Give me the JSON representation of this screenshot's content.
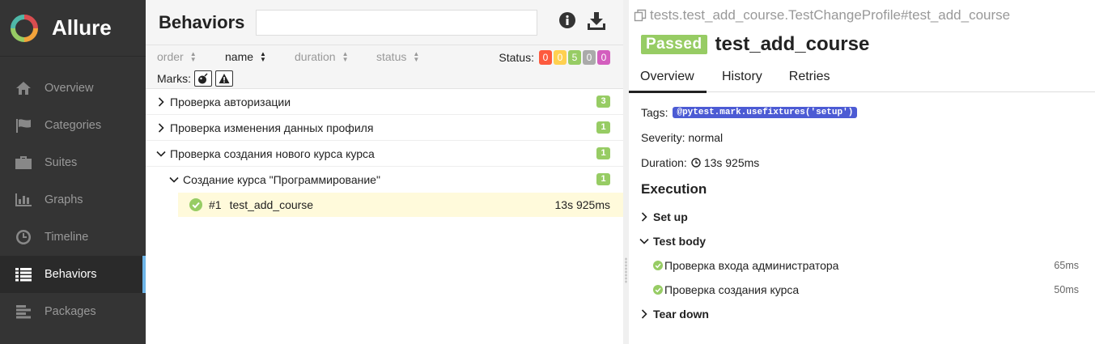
{
  "app": {
    "name": "Allure"
  },
  "sidebar": {
    "items": [
      {
        "label": "Overview",
        "icon": "home-icon"
      },
      {
        "label": "Categories",
        "icon": "flag-icon"
      },
      {
        "label": "Suites",
        "icon": "briefcase-icon"
      },
      {
        "label": "Graphs",
        "icon": "bar-chart-icon"
      },
      {
        "label": "Timeline",
        "icon": "clock-icon"
      },
      {
        "label": "Behaviors",
        "icon": "list-icon",
        "active": true
      },
      {
        "label": "Packages",
        "icon": "align-left-icon"
      }
    ]
  },
  "behaviors": {
    "title": "Behaviors",
    "search": {
      "value": "",
      "placeholder": ""
    },
    "sort": {
      "order": "order",
      "name": "name",
      "duration": "duration",
      "status": "status"
    },
    "status_label": "Status:",
    "status_counts": [
      {
        "value": "0",
        "color": "#fd5a3e"
      },
      {
        "value": "0",
        "color": "#ffd050"
      },
      {
        "value": "5",
        "color": "#97cc64"
      },
      {
        "value": "0",
        "color": "#aaaaaa"
      },
      {
        "value": "0",
        "color": "#d35ebe"
      }
    ],
    "marks_label": "Marks:",
    "tree": [
      {
        "label": "Проверка авторизации",
        "count": "3",
        "expanded": false
      },
      {
        "label": "Проверка изменения данных профиля",
        "count": "1",
        "expanded": false
      },
      {
        "label": "Проверка создания нового курса курса",
        "count": "1",
        "expanded": true
      },
      {
        "label": "Создание курса \"Программирование\"",
        "count": "1",
        "expanded": true
      }
    ],
    "leaf": {
      "number": "#1",
      "name": "test_add_course",
      "duration": "13s 925ms",
      "status": "passed"
    }
  },
  "testcase": {
    "full_name": "tests.test_add_course.TestChangeProfile#test_add_course",
    "status": "Passed",
    "title": "test_add_course",
    "tabs": [
      "Overview",
      "History",
      "Retries"
    ],
    "tags_label": "Tags:",
    "tag": "@pytest.mark.usefixtures('setup')",
    "severity": "Severity: normal",
    "duration_label": "Duration:",
    "duration": "13s 925ms",
    "execution_title": "Execution",
    "setup": "Set up",
    "test_body": "Test body",
    "steps": [
      {
        "name": "Проверка входа администратора",
        "duration": "65ms"
      },
      {
        "name": "Проверка создания курса",
        "duration": "50ms"
      }
    ],
    "teardown": "Tear down"
  },
  "colors": {
    "passed": "#97cc64",
    "tag": "#4c5bd4",
    "sidebar": "#343434",
    "active_marker": "#6eb5e8",
    "selected_row": "#fffadb"
  }
}
